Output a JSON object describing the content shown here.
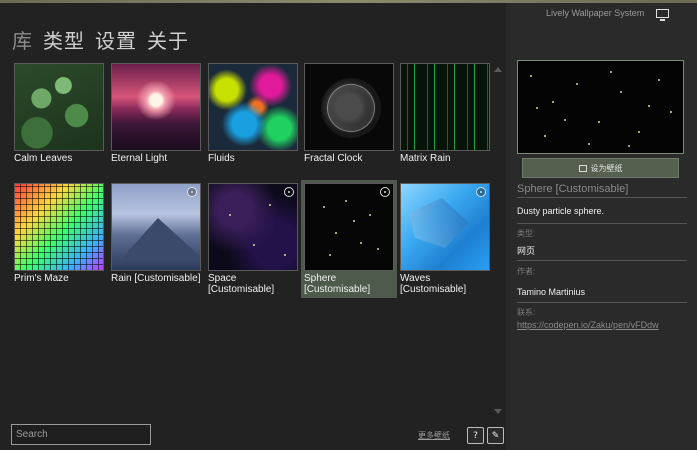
{
  "nav": {
    "library": "库",
    "type": "类型",
    "settings": "设置",
    "about": "关于"
  },
  "tiles": [
    {
      "label": "Calm Leaves"
    },
    {
      "label": "Eternal Light"
    },
    {
      "label": "Fluids"
    },
    {
      "label": "Fractal Clock"
    },
    {
      "label": "Matrix Rain"
    },
    {
      "label": "Prim's Maze"
    },
    {
      "label": "Rain [Customisable]"
    },
    {
      "label": "Space [Customisable]"
    },
    {
      "label": "Sphere [Customisable]"
    },
    {
      "label": "Waves [Customisable]"
    }
  ],
  "selected_index": 8,
  "search": {
    "placeholder": "Search"
  },
  "more_wallpapers": "更多壁纸",
  "side": {
    "app_title": "Lively Wallpaper System",
    "set_button": "设为壁纸",
    "title": "Sphere [Customisable]",
    "description": "Dusty particle sphere.",
    "type_label": "类型:",
    "type_value": "网页",
    "author_label": "作者:",
    "author_value": "Tamino Martinius",
    "contact_label": "联系:",
    "contact_link": "https://codepen.io/Zaku/pen/vFDdw"
  },
  "colors": {
    "accent": "#55604f",
    "background": "#222222",
    "panel": "#2a2a2a"
  },
  "icons": [
    "monitor-icon",
    "image-icon",
    "help-icon",
    "edit-icon",
    "customise-gear-icon",
    "scroll-up-icon",
    "scroll-down-icon"
  ]
}
